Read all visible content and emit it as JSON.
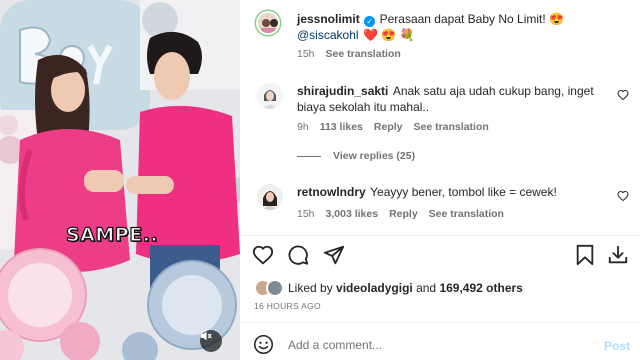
{
  "media": {
    "overlay_caption": "SAMPE.."
  },
  "post": {
    "author": "jessnolimit",
    "caption_text": "Perasaan dapat Baby No Limit! 😍",
    "caption_mention": "@siscakohl",
    "caption_emojis": "❤️ 😍 💐",
    "time": "15h",
    "see_translation": "See translation"
  },
  "comments": [
    {
      "username": "shirajudin_sakti",
      "text_line1": "Anak satu aja udah cukup bang, inget",
      "text_line2": "biaya sekolah itu mahal..",
      "time": "9h",
      "likes": "113 likes",
      "reply": "Reply",
      "see_translation": "See translation",
      "view_replies": "View replies (25)"
    },
    {
      "username": "retnowlndry",
      "text": "Yeayyy bener, tombol like = cewek!",
      "time": "15h",
      "likes": "3,003 likes",
      "reply": "Reply",
      "see_translation": "See translation"
    }
  ],
  "likes": {
    "prefix": "Liked by",
    "user": "videoladygigi",
    "and": "and",
    "others": "169,492 others"
  },
  "timestamp": "16 HOURS AGO",
  "composer": {
    "placeholder": "Add a comment...",
    "post_label": "Post"
  },
  "colors": {
    "verified": "#0095f6",
    "post_disabled": "#b2dffc",
    "muted_text": "#737373",
    "shirt_pink": "#ee2f82"
  }
}
